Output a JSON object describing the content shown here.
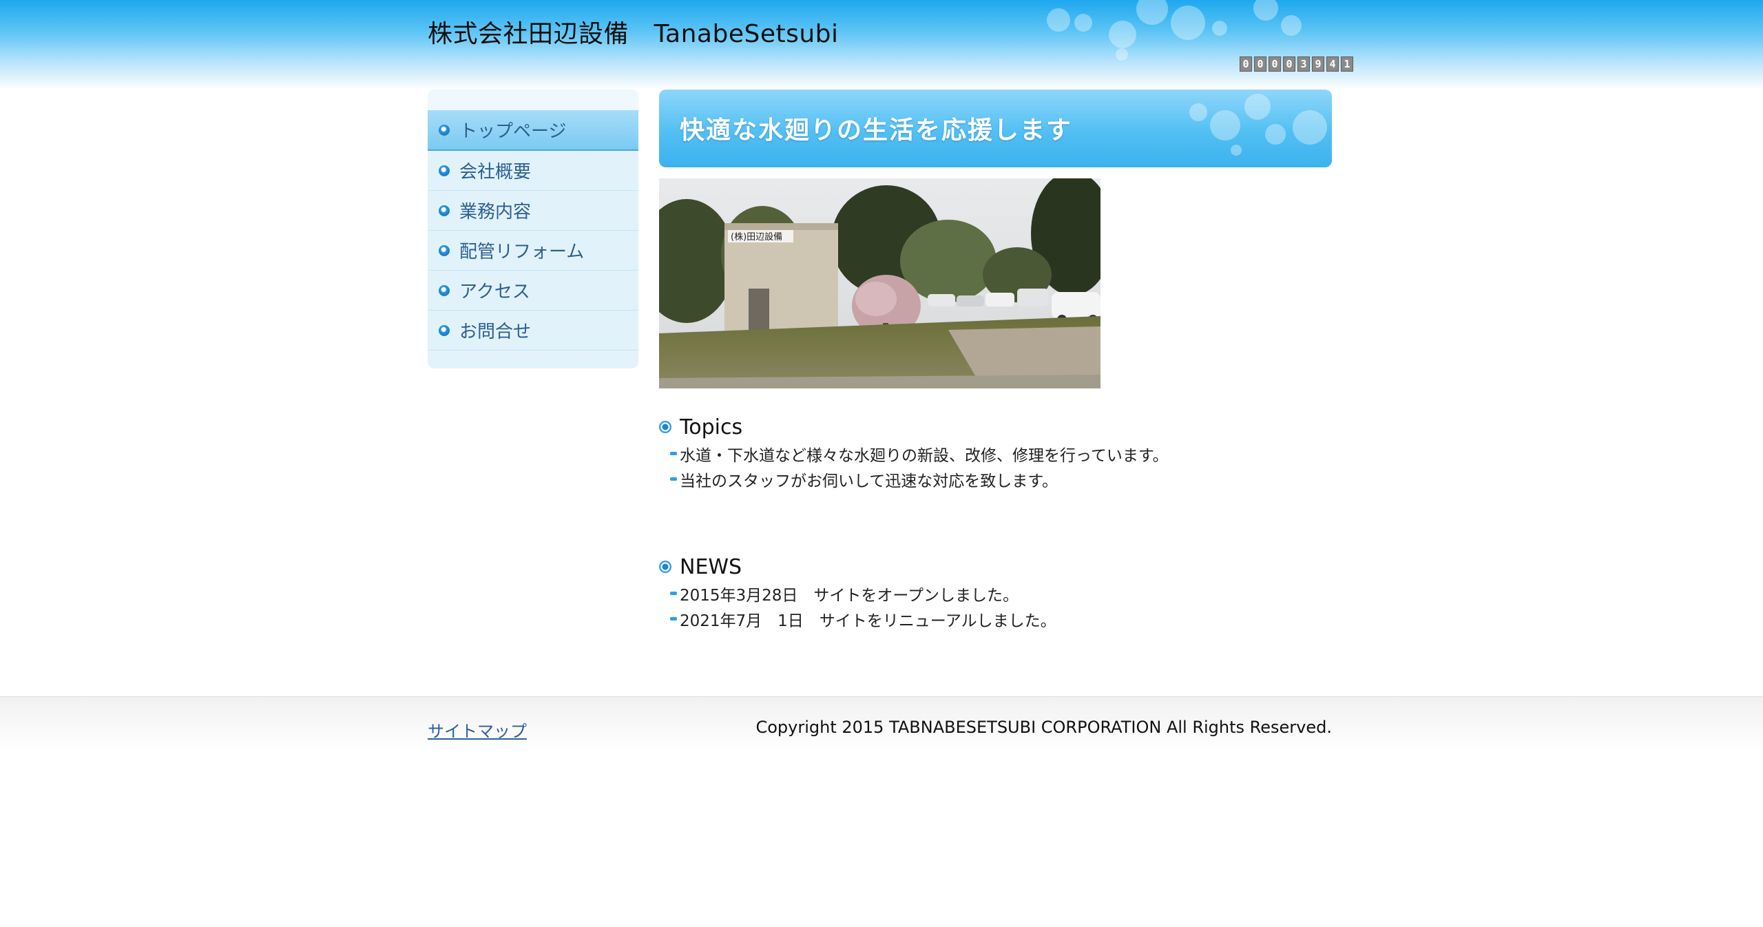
{
  "header": {
    "site_title": "株式会社田辺設備　TanabeSetsubi",
    "counter_digits": [
      "0",
      "0",
      "0",
      "0",
      "3",
      "9",
      "4",
      "1"
    ]
  },
  "sidebar": {
    "items": [
      {
        "label": "トップページ",
        "active": true
      },
      {
        "label": "会社概要",
        "active": false
      },
      {
        "label": "業務内容",
        "active": false
      },
      {
        "label": "配管リフォーム",
        "active": false
      },
      {
        "label": "アクセス",
        "active": false
      },
      {
        "label": "お問合せ",
        "active": false
      }
    ]
  },
  "main": {
    "hero_text": "快適な水廻りの生活を応援します",
    "topics": {
      "title": "Topics",
      "items": [
        "水道・下水道など様々な水廻りの新設、改修、修理を行っています。",
        "当社のスタッフがお伺いして迅速な対応を致します。"
      ]
    },
    "news": {
      "title": "NEWS",
      "items": [
        "2015年3月28日　サイトをオープンしました。",
        "2021年7月　1日　サイトをリニューアルしました。"
      ]
    }
  },
  "footer": {
    "sitemap_label": "サイトマップ",
    "copyright": "Copyright 2015 TABNABESETSUBI CORPORATION All Rights Reserved."
  },
  "colors": {
    "brand_blue": "#1ea8ef",
    "nav_text": "#2c5f8f",
    "link": "#2c5f9e"
  }
}
